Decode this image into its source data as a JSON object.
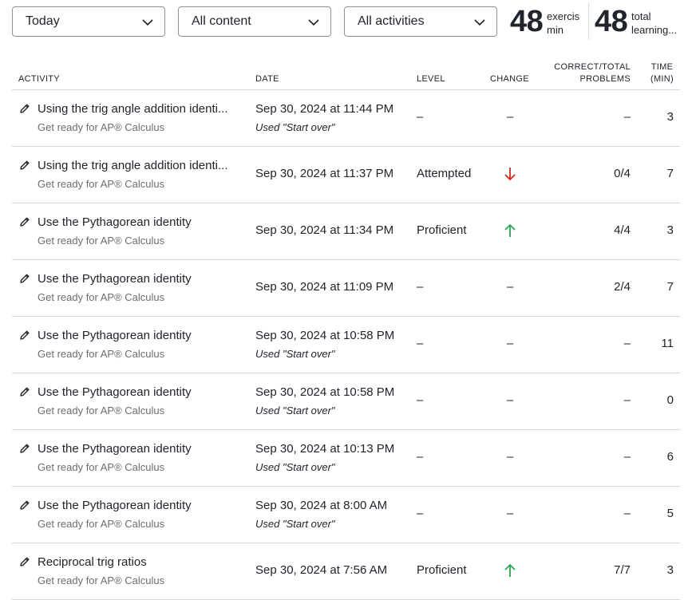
{
  "filters": {
    "date": "Today",
    "content": "All content",
    "activity": "All activities"
  },
  "stats": {
    "exercises": {
      "value": "48",
      "label_line1": "exercis",
      "label_line2": "min"
    },
    "total": {
      "value": "48",
      "label_line1": "total",
      "label_line2": "learning..."
    }
  },
  "table": {
    "headers": {
      "activity": "ACTIVITY",
      "date": "DATE",
      "level": "LEVEL",
      "change": "CHANGE",
      "problems_line1": "CORRECT/TOTAL",
      "problems_line2": "PROBLEMS",
      "time_line1": "TIME",
      "time_line2": "(MIN)"
    },
    "rows": [
      {
        "title": "Using the trig angle addition identi...",
        "course": "Get ready for AP® Calculus",
        "date": "Sep 30, 2024 at 11:44 PM",
        "note": "Used \"Start over\"",
        "level": "–",
        "change": "none",
        "change_text": "–",
        "score": "–",
        "time": "3"
      },
      {
        "title": "Using the trig angle addition identi...",
        "course": "Get ready for AP® Calculus",
        "date": "Sep 30, 2024 at 11:37 PM",
        "note": "",
        "level": "Attempted",
        "change": "down",
        "change_text": "",
        "score": "0/4",
        "time": "7"
      },
      {
        "title": "Use the Pythagorean identity",
        "course": "Get ready for AP® Calculus",
        "date": "Sep 30, 2024 at 11:34 PM",
        "note": "",
        "level": "Proficient",
        "change": "up",
        "change_text": "",
        "score": "4/4",
        "time": "3"
      },
      {
        "title": "Use the Pythagorean identity",
        "course": "Get ready for AP® Calculus",
        "date": "Sep 30, 2024 at 11:09 PM",
        "note": "",
        "level": "–",
        "change": "none",
        "change_text": "–",
        "score": "2/4",
        "time": "7"
      },
      {
        "title": "Use the Pythagorean identity",
        "course": "Get ready for AP® Calculus",
        "date": "Sep 30, 2024 at 10:58 PM",
        "note": "Used \"Start over\"",
        "level": "–",
        "change": "none",
        "change_text": "–",
        "score": "–",
        "time": "11"
      },
      {
        "title": "Use the Pythagorean identity",
        "course": "Get ready for AP® Calculus",
        "date": "Sep 30, 2024 at 10:58 PM",
        "note": "Used \"Start over\"",
        "level": "–",
        "change": "none",
        "change_text": "–",
        "score": "–",
        "time": "0"
      },
      {
        "title": "Use the Pythagorean identity",
        "course": "Get ready for AP® Calculus",
        "date": "Sep 30, 2024 at 10:13 PM",
        "note": "Used \"Start over\"",
        "level": "–",
        "change": "none",
        "change_text": "–",
        "score": "–",
        "time": "6"
      },
      {
        "title": "Use the Pythagorean identity",
        "course": "Get ready for AP® Calculus",
        "date": "Sep 30, 2024 at 8:00 AM",
        "note": "Used \"Start over\"",
        "level": "–",
        "change": "none",
        "change_text": "–",
        "score": "–",
        "time": "5"
      },
      {
        "title": "Reciprocal trig ratios",
        "course": "Get ready for AP® Calculus",
        "date": "Sep 30, 2024 at 7:56 AM",
        "note": "",
        "level": "Proficient",
        "change": "up",
        "change_text": "",
        "score": "7/7",
        "time": "3"
      }
    ]
  },
  "icons": {
    "row_icon": "pencil-icon",
    "dropdown_icon": "chevron-down-icon",
    "up_icon": "arrow-up-icon",
    "down_icon": "arrow-down-icon"
  },
  "colors": {
    "up": "#1fab54",
    "down": "#d92916",
    "divider": "#d6d8da",
    "muted": "#6b6d71"
  }
}
